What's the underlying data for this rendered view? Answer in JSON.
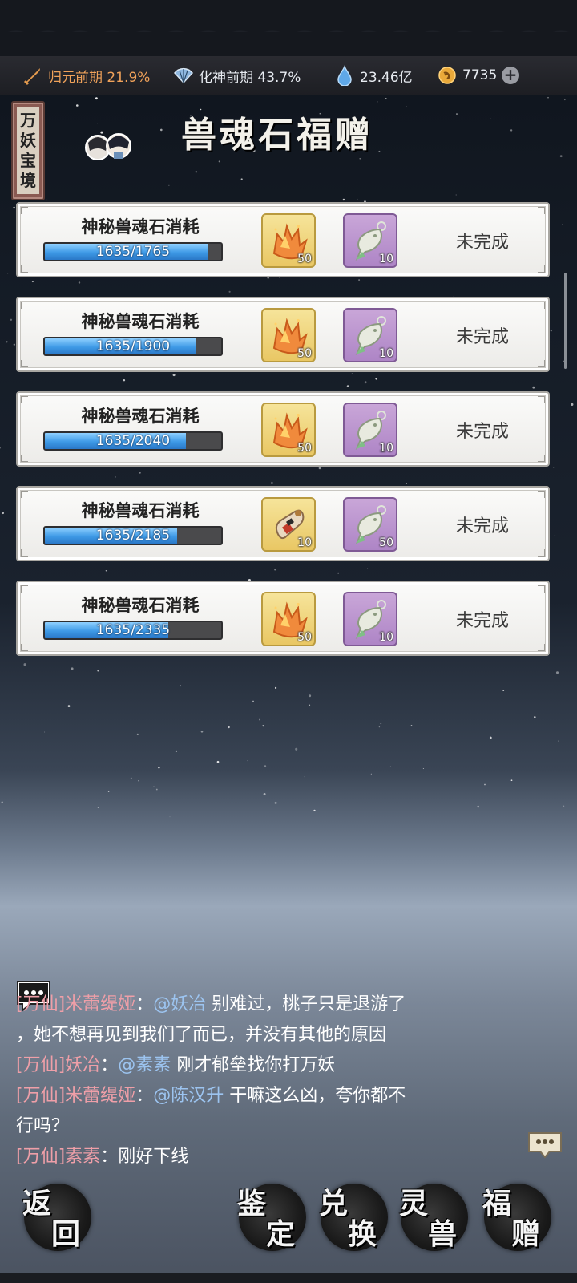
{
  "status_bar": {
    "realm1": {
      "icon": "sword-icon",
      "text": "归元前期 21.9%",
      "color": "#f0a25a"
    },
    "realm2": {
      "icon": "fan-icon",
      "text": "化神前期 43.7%"
    },
    "spirit_stone": {
      "icon": "water-drop-icon",
      "text": "23.46亿"
    },
    "gold": {
      "icon": "gold-coin-icon",
      "text": "7735"
    },
    "add_icon": "plus-icon"
  },
  "side_tab": {
    "label": "万妖宝境"
  },
  "header": {
    "title": "兽魂石福赠",
    "avatar_icon": "character-avatars-icon"
  },
  "tasks": [
    {
      "title": "神秘兽魂石消耗",
      "current": 1635,
      "target": 1765,
      "progress_text": "1635/1765",
      "progress": 0.926,
      "reward1": {
        "icon": "orange-crystal-icon",
        "qty": "50"
      },
      "reward2": {
        "icon": "jade-fish-pendant-icon",
        "qty": "10"
      },
      "status": "未完成"
    },
    {
      "title": "神秘兽魂石消耗",
      "current": 1635,
      "target": 1900,
      "progress_text": "1635/1900",
      "progress": 0.861,
      "reward1": {
        "icon": "orange-crystal-icon",
        "qty": "50"
      },
      "reward2": {
        "icon": "jade-fish-pendant-icon",
        "qty": "10"
      },
      "status": "未完成"
    },
    {
      "title": "神秘兽魂石消耗",
      "current": 1635,
      "target": 2040,
      "progress_text": "1635/2040",
      "progress": 0.801,
      "reward1": {
        "icon": "orange-crystal-icon",
        "qty": "50"
      },
      "reward2": {
        "icon": "jade-fish-pendant-icon",
        "qty": "10"
      },
      "status": "未完成"
    },
    {
      "title": "神秘兽魂石消耗",
      "current": 1635,
      "target": 2185,
      "progress_text": "1635/2185",
      "progress": 0.748,
      "reward1": {
        "icon": "scroll-pouch-icon",
        "qty": "10"
      },
      "reward2": {
        "icon": "jade-fish-pendant-icon",
        "qty": "50"
      },
      "status": "未完成"
    },
    {
      "title": "神秘兽魂石消耗",
      "current": 1635,
      "target": 2335,
      "progress_text": "1635/2335",
      "progress": 0.7,
      "reward1": {
        "icon": "orange-crystal-icon",
        "qty": "50"
      },
      "reward2": {
        "icon": "jade-fish-pendant-icon",
        "qty": "10"
      },
      "status": "未完成"
    }
  ],
  "chat": {
    "icon": "chat-bubble-icon",
    "toggle_icon": "chat-toggle-icon",
    "lines": [
      {
        "channel": "[万仙]",
        "name": "米蕾缇娅",
        "sep": "：",
        "mention": "@妖冶",
        "text": " 别难过，桃子只是退游了"
      },
      {
        "channel": "",
        "name": "",
        "sep": "",
        "mention": "",
        "text": "，她不想再见到我们了而已，并没有其他的原因"
      },
      {
        "channel": "[万仙]",
        "name": "妖冶",
        "sep": "：",
        "mention": "@素素",
        "text": " 刚才郁垒找你打万妖"
      },
      {
        "channel": "[万仙]",
        "name": "米蕾缇娅",
        "sep": "：",
        "mention": "@陈汉升",
        "text": " 干嘛这么凶，夸你都不"
      },
      {
        "channel": "",
        "name": "",
        "sep": "",
        "mention": "",
        "text": "行吗？"
      },
      {
        "channel": "[万仙]",
        "name": "素素",
        "sep": "：",
        "mention": "",
        "text": "刚好下线"
      }
    ]
  },
  "bottom_nav": {
    "back": {
      "c1": "返",
      "c2": "回"
    },
    "appraise": {
      "c1": "鉴",
      "c2": "定"
    },
    "exchange": {
      "c1": "兑",
      "c2": "换"
    },
    "beast": {
      "c1": "灵",
      "c2": "兽"
    },
    "gift": {
      "c1": "福",
      "c2": "赠"
    }
  }
}
